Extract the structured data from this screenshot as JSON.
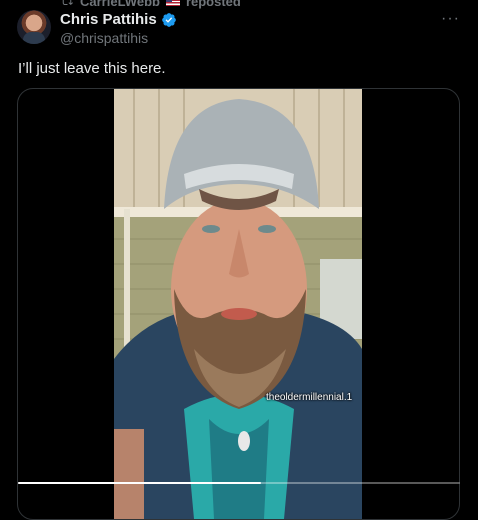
{
  "repost": {
    "user": "CarrieLWebb",
    "label": "reposted",
    "flag_icon": "us-flag-icon"
  },
  "author": {
    "name": "Chris Pattihis",
    "handle": "@chrispattihis",
    "verified": true
  },
  "tweet": {
    "text": "I’ll just leave this here."
  },
  "media": {
    "watermark": "theoldermillennial.1",
    "progress": 0.55
  },
  "menu": {
    "more_label": "···"
  },
  "colors": {
    "background": "#000000",
    "text": "#e7e9ea",
    "muted": "#71767b",
    "verified": "#1d9bf0",
    "border": "#2f3336"
  }
}
